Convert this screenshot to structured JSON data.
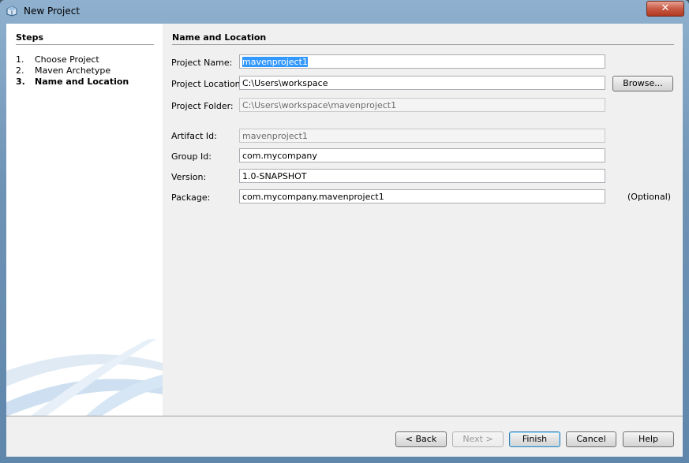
{
  "window": {
    "title": "New Project",
    "close_glyph": "✕"
  },
  "steps": {
    "title": "Steps",
    "items": [
      {
        "num": "1.",
        "label": "Choose Project"
      },
      {
        "num": "2.",
        "label": "Maven Archetype"
      },
      {
        "num": "3.",
        "label": "Name and Location"
      }
    ],
    "current_index": 2
  },
  "form": {
    "title": "Name and Location",
    "project_name_label": "Project Name:",
    "project_name_value": "mavenproject1",
    "project_location_label": "Project Location:",
    "project_location_value": "C:\\Users\\workspace",
    "browse_label": "Browse...",
    "project_folder_label": "Project Folder:",
    "project_folder_value": "C:\\Users\\workspace\\mavenproject1",
    "artifact_id_label": "Artifact Id:",
    "artifact_id_value": "mavenproject1",
    "group_id_label": "Group Id:",
    "group_id_value": "com.mycompany",
    "version_label": "Version:",
    "version_value": "1.0-SNAPSHOT",
    "package_label": "Package:",
    "package_value": "com.mycompany.mavenproject1",
    "optional_label": "(Optional)"
  },
  "buttons": {
    "back": "< Back",
    "next": "Next >",
    "finish": "Finish",
    "cancel": "Cancel",
    "help": "Help"
  },
  "colors": {
    "selection": "#3399ff",
    "title_bar": "#6f93b5",
    "close": "#c75a45"
  }
}
